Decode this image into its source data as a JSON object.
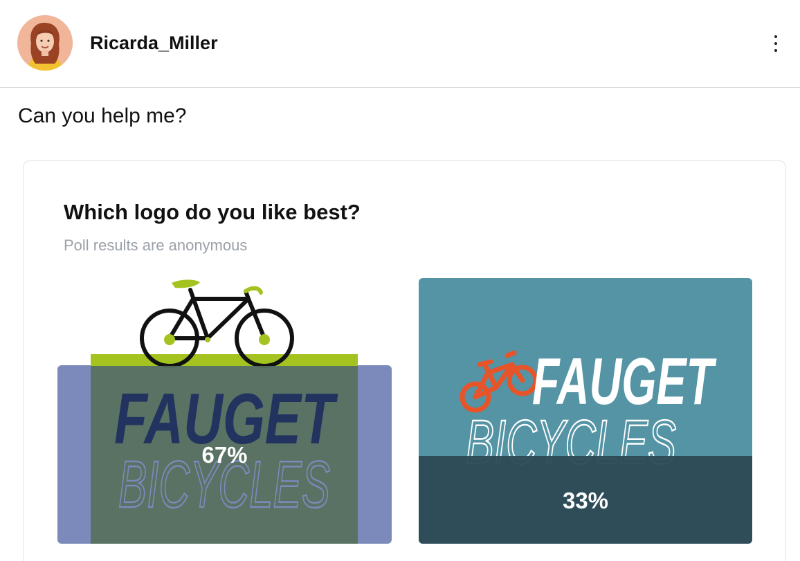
{
  "post": {
    "author": "Ricarda_Miller",
    "text": "Can you help me?"
  },
  "poll": {
    "question": "Which logo do you like best?",
    "note": "Poll results are anonymous",
    "options": [
      {
        "logo_line1": "FAUGET",
        "logo_line2": "BICYCLES",
        "result": "67%",
        "share": 0.67,
        "accent": "#a4c320",
        "overlay": "#56705e"
      },
      {
        "logo_line1": "FAUGET",
        "logo_line2": "BICYCLES",
        "result": "33%",
        "share": 0.33,
        "accent": "#e8542a",
        "overlay": "#2d4a55"
      }
    ]
  },
  "icons": {
    "more": "more-vertical-icon",
    "bicycle": "bicycle-icon"
  },
  "colors": {
    "logo_a_navy": "#1c2d5e",
    "logo_a_panel": "#7b8aba",
    "logo_b_bg": "#5494a4"
  }
}
